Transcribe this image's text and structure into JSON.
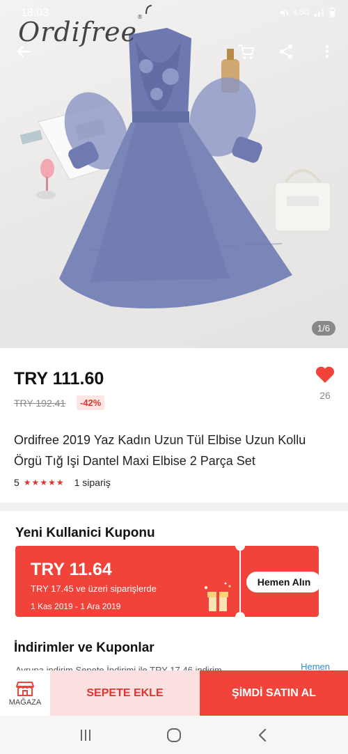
{
  "status_bar": {
    "time": "18:03",
    "network": "4.5G"
  },
  "brand": {
    "name": "Ordifree",
    "trademark": "®"
  },
  "gallery": {
    "counter": "1/6"
  },
  "icons": {
    "back": "arrow-left-icon",
    "cart": "cart-icon",
    "share": "share-icon",
    "more": "more-vertical-icon",
    "like": "heart-icon",
    "store": "store-icon",
    "gift": "gift-icon"
  },
  "product": {
    "price": "TRY 111.60",
    "old_price": "TRY 192.41",
    "discount": "-42%",
    "likes": "26",
    "title": "Ordifree 2019 Yaz Kadın Uzun Tül Elbise Uzun Kollu Örgü Tığ Işi Dantel Maxi Elbise 2 Parça Set",
    "rating": "5",
    "stars": "★★★★★",
    "orders": "1 sipariş"
  },
  "coupon": {
    "section_title": "Yeni Kullanici Kuponu",
    "amount": "TRY 11.64",
    "condition": "TRY 17.45 ve üzeri siparişlerde",
    "dates": "1 Kas 2019 - 1 Ara 2019",
    "claim_label": "Hemen Alın"
  },
  "discounts": {
    "section_title": "İndirimler ve Kuponlar",
    "peek_text": "Avrupa indirim Sepete İndirimi ile TRY 17.46 indirim",
    "more_label": "Hemen"
  },
  "actions": {
    "store_label": "MAĞAZA",
    "add_to_cart": "SEPETE EKLE",
    "buy_now": "ŞİMDİ SATIN AL"
  },
  "colors": {
    "accent": "#f0443b",
    "accent_light": "#fde0e0",
    "dress": "#7b86b8",
    "link": "#2b8bd6"
  }
}
